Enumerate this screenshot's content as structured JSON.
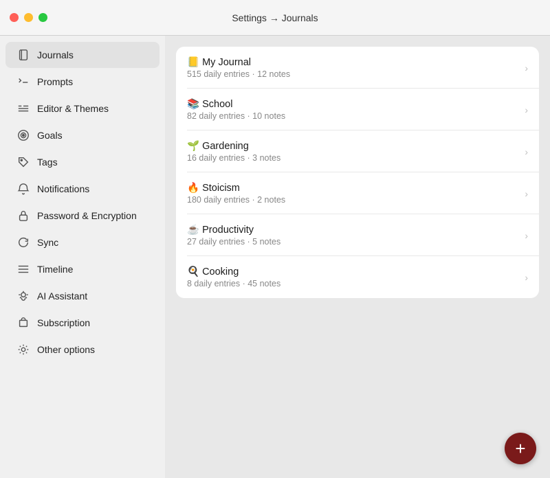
{
  "titleBar": {
    "title": "Settings → Journals"
  },
  "sidebar": {
    "items": [
      {
        "id": "journals",
        "label": "Journals",
        "icon": "journals",
        "active": true
      },
      {
        "id": "prompts",
        "label": "Prompts",
        "icon": "prompts",
        "active": false
      },
      {
        "id": "editor-themes",
        "label": "Editor & Themes",
        "icon": "editor",
        "active": false
      },
      {
        "id": "goals",
        "label": "Goals",
        "icon": "goals",
        "active": false
      },
      {
        "id": "tags",
        "label": "Tags",
        "icon": "tags",
        "active": false
      },
      {
        "id": "notifications",
        "label": "Notifications",
        "icon": "notifications",
        "active": false
      },
      {
        "id": "password-encryption",
        "label": "Password & Encryption",
        "icon": "lock",
        "active": false
      },
      {
        "id": "sync",
        "label": "Sync",
        "icon": "sync",
        "active": false
      },
      {
        "id": "timeline",
        "label": "Timeline",
        "icon": "timeline",
        "active": false
      },
      {
        "id": "ai-assistant",
        "label": "AI Assistant",
        "icon": "ai",
        "active": false
      },
      {
        "id": "subscription",
        "label": "Subscription",
        "icon": "subscription",
        "active": false
      },
      {
        "id": "other-options",
        "label": "Other options",
        "icon": "settings",
        "active": false
      }
    ]
  },
  "journals": [
    {
      "emoji": "📒",
      "name": "My Journal",
      "entries": 515,
      "notes": 12
    },
    {
      "emoji": "📚",
      "name": "School",
      "entries": 82,
      "notes": 10
    },
    {
      "emoji": "🌱",
      "name": "Gardening",
      "entries": 16,
      "notes": 3
    },
    {
      "emoji": "🔥",
      "name": "Stoicism",
      "entries": 180,
      "notes": 2
    },
    {
      "emoji": "☕",
      "name": "Productivity",
      "entries": 27,
      "notes": 5
    },
    {
      "emoji": "🍳",
      "name": "Cooking",
      "entries": 8,
      "notes": 45
    }
  ],
  "fab": {
    "label": "+"
  }
}
